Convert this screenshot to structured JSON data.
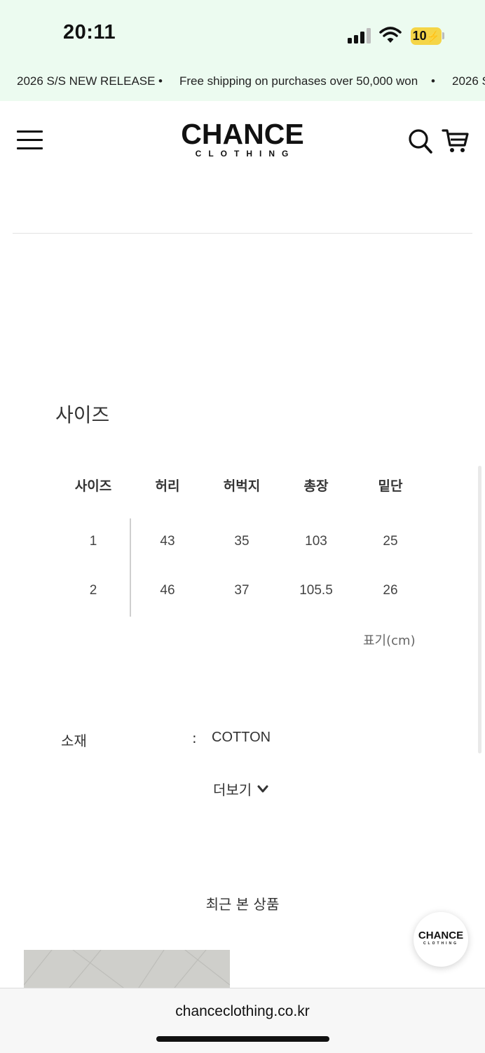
{
  "status_bar": {
    "time": "20:11",
    "battery": "10"
  },
  "ticker": {
    "items": [
      "2026 S/S NEW RELEASE",
      "•",
      "Free shipping on purchases over 50,000 won",
      "•",
      "2026 S"
    ]
  },
  "header": {
    "logo_main": "CHANCE",
    "logo_sub": "CLOTHING"
  },
  "size_section": {
    "title": "사이즈",
    "columns": [
      "사이즈",
      "허리",
      "허벅지",
      "총장",
      "밑단"
    ],
    "rows": [
      [
        "1",
        "43",
        "35",
        "103",
        "25"
      ],
      [
        "2",
        "46",
        "37",
        "105.5",
        "26"
      ]
    ],
    "unit_note": "표기(cm)"
  },
  "material": {
    "label": "소재",
    "separator": ":",
    "value": "COTTON"
  },
  "more_button": {
    "label": "더보기"
  },
  "recent": {
    "title": "최근 본 상품"
  },
  "float_logo": {
    "main": "CHANCE",
    "sub": "CLOTHING"
  },
  "browser": {
    "url": "chanceclothing.co.kr"
  },
  "colors": {
    "banner_bg": "#ecfbf0",
    "battery": "#f5d547"
  }
}
